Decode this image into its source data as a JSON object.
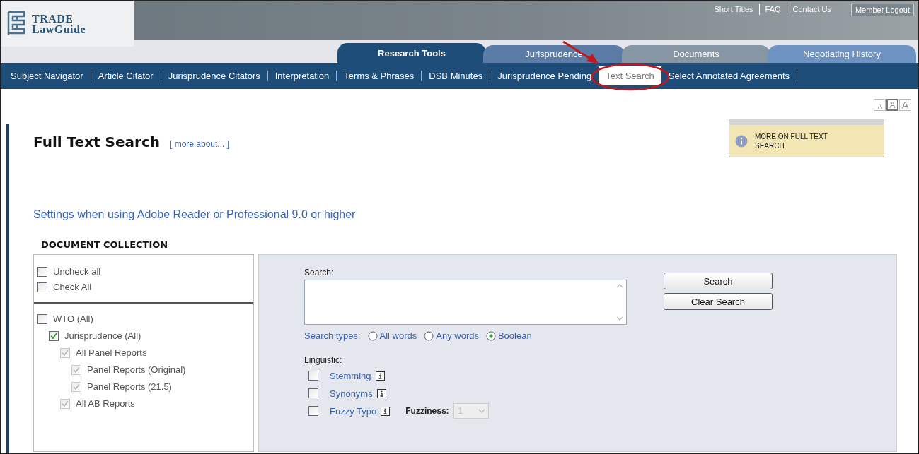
{
  "logo": {
    "line1": "TRADE",
    "line2": "LawGuide"
  },
  "top_links": [
    {
      "label": "Short Titles",
      "kind": "link"
    },
    {
      "label": "FAQ",
      "kind": "link"
    },
    {
      "label": "Contact Us",
      "kind": "link"
    },
    {
      "label": "Member Logout",
      "kind": "button"
    }
  ],
  "tabs": [
    {
      "label": "Research Tools",
      "selected": true,
      "color": "#1f4d7a"
    },
    {
      "label": "Jurisprudence",
      "selected": false,
      "color": "#5a7ca6"
    },
    {
      "label": "Documents",
      "selected": false,
      "color": "#8796a4"
    },
    {
      "label": "Negotiating History",
      "selected": false,
      "color": "#6e93c2"
    }
  ],
  "subnav": [
    {
      "label": "Subject Navigator",
      "selected": false
    },
    {
      "label": "Article Citator",
      "selected": false
    },
    {
      "label": "Jurisprudence Citators",
      "selected": false
    },
    {
      "label": "Interpretation",
      "selected": false
    },
    {
      "label": "Terms & Phrases",
      "selected": false
    },
    {
      "label": "DSB Minutes",
      "selected": false
    },
    {
      "label": "Jurisprudence Pending",
      "selected": false
    },
    {
      "label": "Text Search",
      "selected": true
    },
    {
      "label": "Select Annotated Agreements",
      "selected": false
    }
  ],
  "font_sizes": [
    {
      "label": "A",
      "selected": false
    },
    {
      "label": "A",
      "selected": true
    },
    {
      "label": "A",
      "selected": false
    }
  ],
  "page_title": "Full Text Search",
  "more_about": "[ more about... ]",
  "info_box": "MORE ON FULL TEXT SEARCH",
  "settings_link": "Settings when using Adobe Reader or Professional 9.0 or higher",
  "collection_heading": "DOCUMENT COLLECTION",
  "bulk_options": [
    {
      "label": "Uncheck all",
      "checked": false
    },
    {
      "label": "Check All",
      "checked": false
    }
  ],
  "collection_tree": [
    {
      "label": "WTO (All)",
      "checked": false,
      "disabled": false,
      "children": [
        {
          "label": "Jurisprudence (All)",
          "checked": true,
          "disabled": false,
          "children": [
            {
              "label": "All Panel Reports",
              "checked": true,
              "disabled": true,
              "children": [
                {
                  "label": "Panel Reports (Original)",
                  "checked": true,
                  "disabled": true
                },
                {
                  "label": "Panel Reports (21.5)",
                  "checked": true,
                  "disabled": true
                }
              ]
            },
            {
              "label": "All AB Reports",
              "checked": true,
              "disabled": true
            }
          ]
        }
      ]
    }
  ],
  "search": {
    "label": "Search:",
    "buttons": [
      "Search",
      "Clear Search"
    ]
  },
  "search_types": {
    "label": "Search types:",
    "options": [
      {
        "label": "All words",
        "selected": false
      },
      {
        "label": "Any words",
        "selected": false
      },
      {
        "label": "Boolean",
        "selected": true
      }
    ]
  },
  "linguistic": {
    "label": "Linguistic:",
    "options": [
      {
        "label": "Stemming",
        "checked": false
      },
      {
        "label": "Synonyms",
        "checked": false
      },
      {
        "label": "Fuzzy Typo",
        "checked": false
      }
    ],
    "fuzziness": {
      "label": "Fuzziness:",
      "value": "1",
      "disabled": true
    }
  }
}
